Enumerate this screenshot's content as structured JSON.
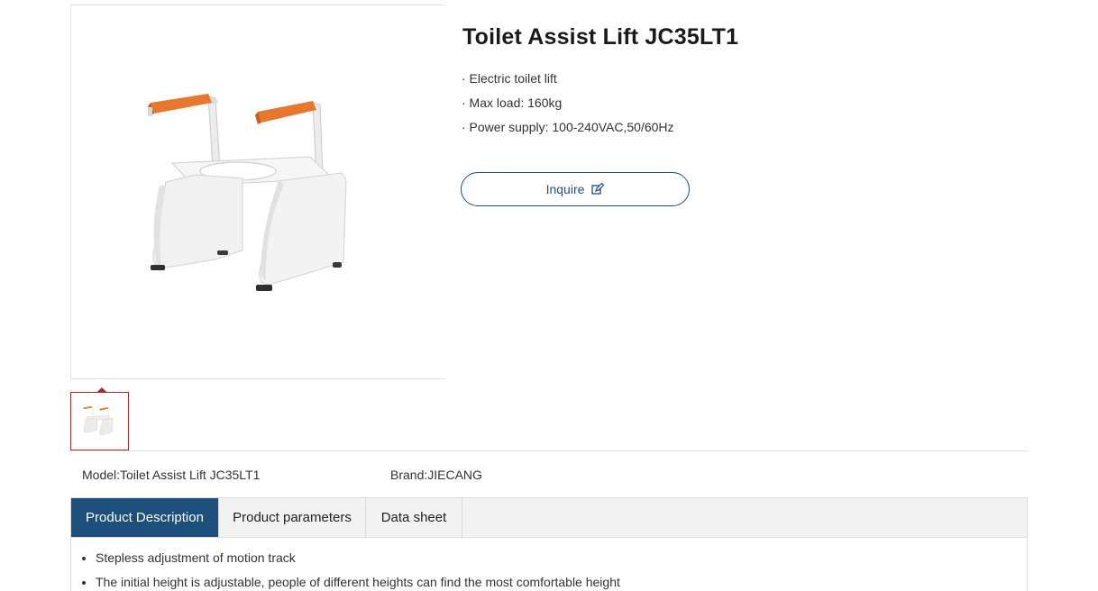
{
  "product": {
    "title": "Toilet Assist Lift JC35LT1",
    "features": [
      "· Electric toilet lift",
      "· Max load: 160kg",
      "· Power supply: 100-240VAC,50/60Hz"
    ],
    "inquire_label": "Inquire",
    "model": "Model:Toilet Assist Lift JC35LT1",
    "brand": "Brand:JIECANG"
  },
  "tabs": [
    {
      "label": "Product Description",
      "active": true
    },
    {
      "label": "Product parameters",
      "active": false
    },
    {
      "label": "Data sheet",
      "active": false
    }
  ],
  "description": {
    "items": [
      "Stepless adjustment of motion track",
      "The initial height is adjustable, people of different heights can find the most comfortable height"
    ]
  },
  "colors": {
    "accent": "#1c4f7c",
    "armrest": "#e8772e",
    "thumb_border": "#a32a2a"
  },
  "icons": {
    "inquire": "edit-icon"
  }
}
